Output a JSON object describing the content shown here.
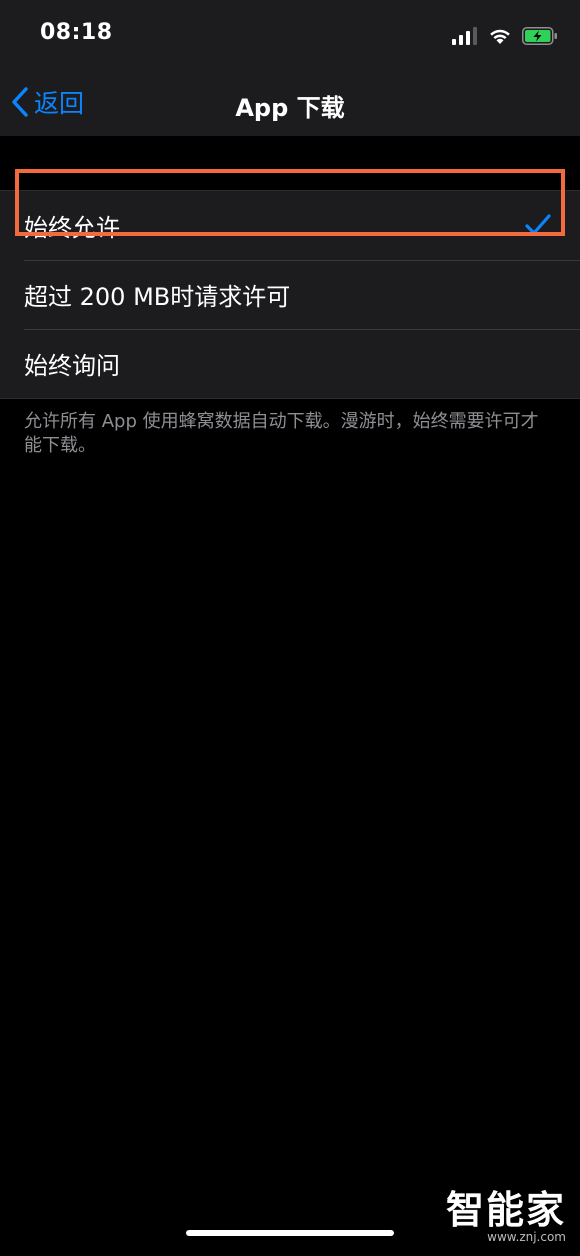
{
  "status_bar": {
    "time": "08:18",
    "icons": [
      "cellular-signal-icon",
      "wifi-icon",
      "battery-charging-icon"
    ]
  },
  "nav": {
    "back_label": "返回",
    "title": "App 下载"
  },
  "options": [
    {
      "label": "始终允许",
      "selected": true
    },
    {
      "label": "超过 200 MB时请求许可",
      "selected": false
    },
    {
      "label": "始终询问",
      "selected": false
    }
  ],
  "footer_note": "允许所有 App 使用蜂窝数据自动下载。漫游时，始终需要许可才能下载。",
  "watermark": {
    "logo": "智能家",
    "url": "www.znj.com"
  },
  "colors": {
    "accent": "#0a84ff",
    "highlight": "#f26a3d",
    "battery": "#30d158"
  }
}
